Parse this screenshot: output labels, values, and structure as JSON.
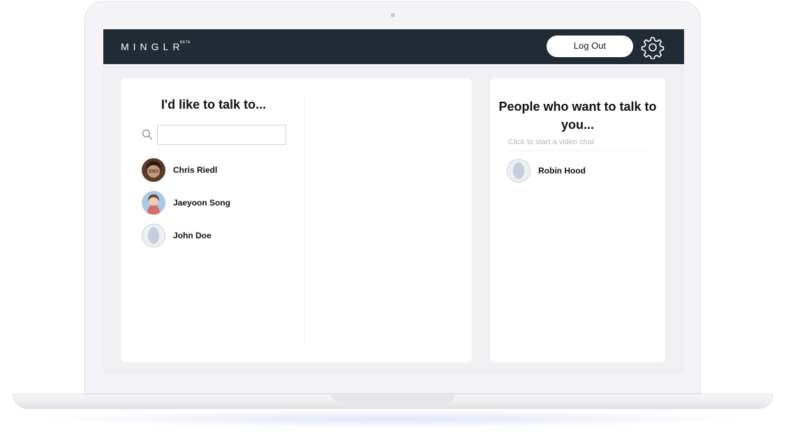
{
  "header": {
    "brand": "MINGLR",
    "badge": "BETA",
    "logout_label": "Log Out",
    "settings_icon": "gear-icon",
    "background": "#212b36"
  },
  "left_panel": {
    "title": "I'd like to talk to...",
    "search": {
      "value": "",
      "placeholder": "",
      "icon": "search-icon"
    },
    "contacts": [
      {
        "name": "Chris Riedl",
        "avatar": "photo"
      },
      {
        "name": "Jaeyoon Song",
        "avatar": "photo"
      },
      {
        "name": "John Doe",
        "avatar": "default"
      }
    ]
  },
  "right_panel": {
    "title": "People who want to talk to you...",
    "hint": "Click to start a video chat",
    "requests": [
      {
        "name": "Robin Hood",
        "avatar": "default"
      }
    ]
  }
}
